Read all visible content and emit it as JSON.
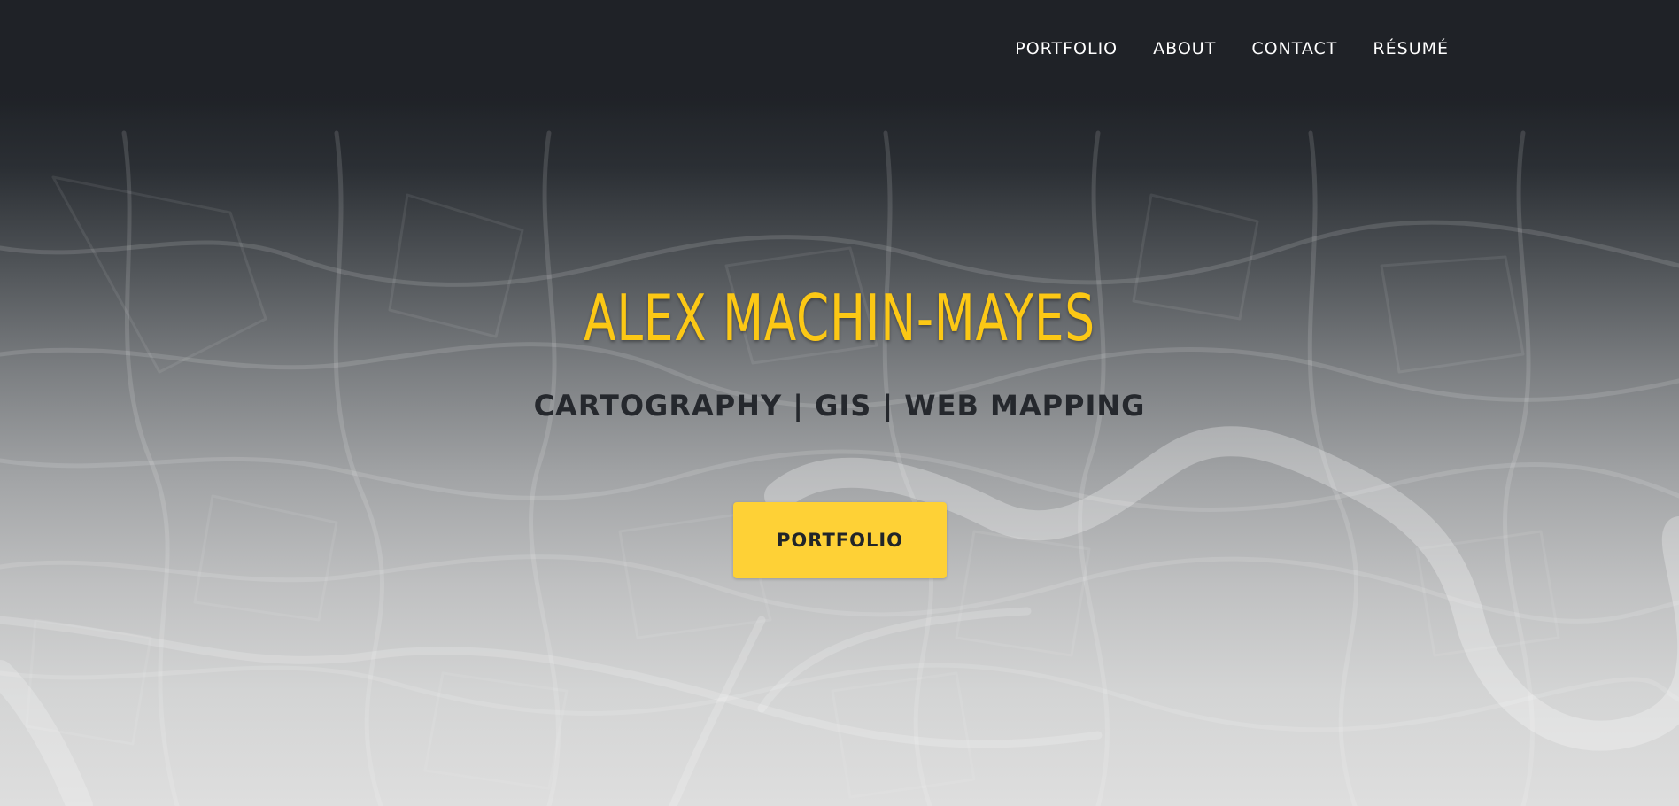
{
  "nav": {
    "items": [
      {
        "label": "PORTFOLIO"
      },
      {
        "label": "ABOUT"
      },
      {
        "label": "CONTACT"
      },
      {
        "label": "RÉSUMÉ"
      }
    ]
  },
  "hero": {
    "title": "ALEX MACHIN-MAYES",
    "subtitle": "CARTOGRAPHY | GIS | WEB MAPPING",
    "button_label": "PORTFOLIO"
  },
  "colors": {
    "accent": "#fed136",
    "title": "#fcc815",
    "dark": "#212529"
  }
}
